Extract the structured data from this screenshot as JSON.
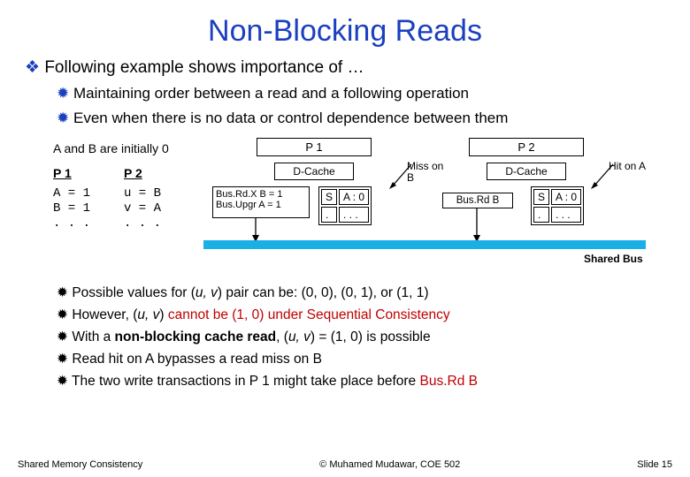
{
  "title": "Non-Blocking Reads",
  "bullet1": "Following example shows importance of …",
  "bullet2a": "Maintaining order between a read and a following operation",
  "bullet2b": "Even when there is no data or control dependence between them",
  "diagram": {
    "init": "A and B are initially 0",
    "p1h": "P 1",
    "p2h": "P 2",
    "p1code1": "A  =  1",
    "p1code2": "B  =  1",
    "p1dots": ". . .",
    "p2code1": "u  =  B",
    "p2code2": "v  =  A",
    "p2dots": ". . .",
    "p1label": "P 1",
    "p2label": "P 2",
    "dcache": "D-Cache",
    "busrdx": "Bus.Rd.X B = 1",
    "busupgr": "Bus.Upgr A = 1",
    "s": "S",
    "a0": "A : 0",
    "dot": ".",
    "dots": ". . .",
    "miss": "Miss on B",
    "hit": "Hit on A",
    "busrdb": "Bus.Rd B",
    "sharedbus": "Shared Bus"
  },
  "b3a_pre": "Possible values for (",
  "b3a_uv": "u, v",
  "b3a_post": ") pair can be: (0, 0), (0, 1), or (1, 1)",
  "b3b_pre": "However, (",
  "b3b_uv": "u, v",
  "b3b_mid": ") ",
  "b3b_red": "cannot be (1, 0) under Sequential Consistency",
  "b3c_pre": "With a ",
  "b3c_bold": "non-blocking cache read",
  "b3c_mid": ", (",
  "b3c_uv": "u, v",
  "b3c_post": ") = (1, 0) is possible",
  "b3d": "Read hit on A bypasses a read miss on B",
  "b3e_pre": "The two write transactions in P 1 might take place before ",
  "b3e_red": "Bus.Rd B",
  "footer": {
    "left": "Shared Memory Consistency",
    "center": "© Muhamed Mudawar, COE 502",
    "right": "Slide 15"
  }
}
